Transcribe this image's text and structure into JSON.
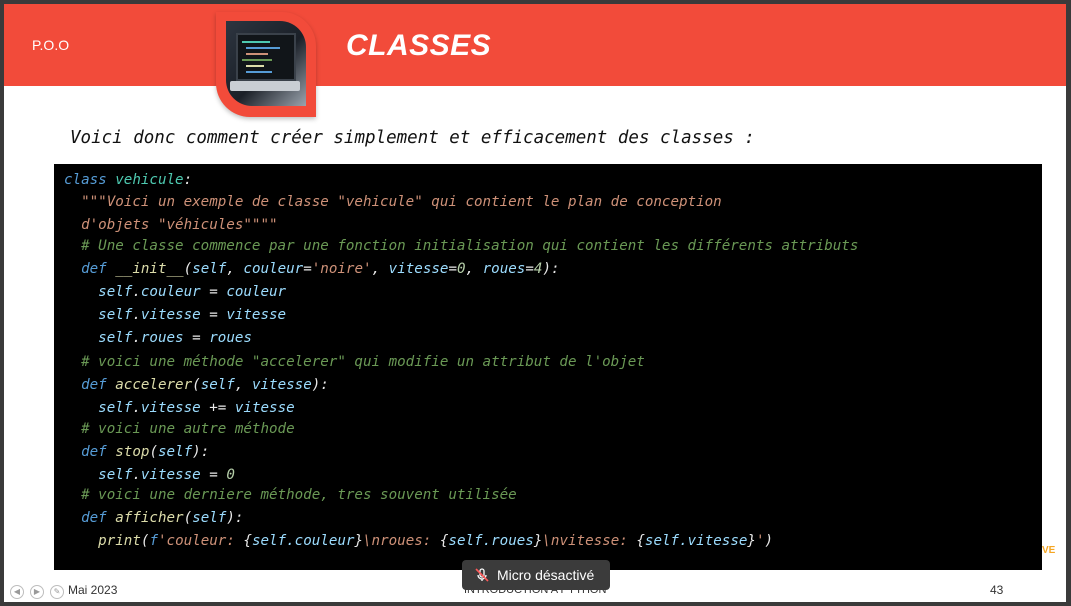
{
  "header": {
    "subtitle": "P.O.O",
    "title": "CLASSES"
  },
  "intro": "Voici donc comment créer simplement et efficacement des classes :",
  "code": {
    "lines": [
      {
        "indent": "",
        "parts": [
          [
            "kw",
            "class "
          ],
          [
            "cls",
            "vehicule"
          ],
          [
            "txt",
            ":"
          ]
        ]
      },
      {
        "indent": "  ",
        "parts": [
          [
            "str",
            "\"\"\"Voici un exemple de classe \"vehicule\" qui contient le plan de conception"
          ]
        ]
      },
      {
        "indent": "  ",
        "parts": [
          [
            "str",
            "d'objets \"véhicules\"\"\"\""
          ]
        ]
      },
      {
        "indent": "  ",
        "parts": [
          [
            "cmt",
            "# Une classe commence par une fonction initialisation qui contient les différents attributs"
          ]
        ]
      },
      {
        "indent": "  ",
        "parts": [
          [
            "kw",
            "def "
          ],
          [
            "fn",
            "__init__"
          ],
          [
            "txt",
            "("
          ],
          [
            "var",
            "self"
          ],
          [
            "txt",
            ", "
          ],
          [
            "var",
            "couleur"
          ],
          [
            "txt",
            "="
          ],
          [
            "str",
            "'noire'"
          ],
          [
            "txt",
            ", "
          ],
          [
            "var",
            "vitesse"
          ],
          [
            "txt",
            "="
          ],
          [
            "num",
            "0"
          ],
          [
            "txt",
            ", "
          ],
          [
            "var",
            "roues"
          ],
          [
            "txt",
            "="
          ],
          [
            "num",
            "4"
          ],
          [
            "txt",
            "):"
          ]
        ]
      },
      {
        "indent": "    ",
        "parts": [
          [
            "var",
            "self"
          ],
          [
            "txt",
            "."
          ],
          [
            "var",
            "couleur"
          ],
          [
            "txt",
            " = "
          ],
          [
            "var",
            "couleur"
          ]
        ]
      },
      {
        "indent": "    ",
        "parts": [
          [
            "var",
            "self"
          ],
          [
            "txt",
            "."
          ],
          [
            "var",
            "vitesse"
          ],
          [
            "txt",
            " = "
          ],
          [
            "var",
            "vitesse"
          ]
        ]
      },
      {
        "indent": "    ",
        "parts": [
          [
            "var",
            "self"
          ],
          [
            "txt",
            "."
          ],
          [
            "var",
            "roues"
          ],
          [
            "txt",
            " = "
          ],
          [
            "var",
            "roues"
          ]
        ]
      },
      {
        "indent": "  ",
        "parts": [
          [
            "cmt",
            "# voici une méthode \"accelerer\" qui modifie un attribut de l'objet"
          ]
        ]
      },
      {
        "indent": "  ",
        "parts": [
          [
            "kw",
            "def "
          ],
          [
            "fn",
            "accelerer"
          ],
          [
            "txt",
            "("
          ],
          [
            "var",
            "self"
          ],
          [
            "txt",
            ", "
          ],
          [
            "var",
            "vitesse"
          ],
          [
            "txt",
            "):"
          ]
        ]
      },
      {
        "indent": "    ",
        "parts": [
          [
            "var",
            "self"
          ],
          [
            "txt",
            "."
          ],
          [
            "var",
            "vitesse"
          ],
          [
            "txt",
            " += "
          ],
          [
            "var",
            "vitesse"
          ]
        ]
      },
      {
        "indent": "  ",
        "parts": [
          [
            "cmt",
            "# voici une autre méthode"
          ]
        ]
      },
      {
        "indent": "  ",
        "parts": [
          [
            "kw",
            "def "
          ],
          [
            "fn",
            "stop"
          ],
          [
            "txt",
            "("
          ],
          [
            "var",
            "self"
          ],
          [
            "txt",
            "):"
          ]
        ]
      },
      {
        "indent": "    ",
        "parts": [
          [
            "var",
            "self"
          ],
          [
            "txt",
            "."
          ],
          [
            "var",
            "vitesse"
          ],
          [
            "txt",
            " = "
          ],
          [
            "num",
            "0"
          ]
        ]
      },
      {
        "indent": "  ",
        "parts": [
          [
            "cmt",
            "# voici une derniere méthode, tres souvent utilisée"
          ]
        ]
      },
      {
        "indent": "  ",
        "parts": [
          [
            "kw",
            "def "
          ],
          [
            "fn",
            "afficher"
          ],
          [
            "txt",
            "("
          ],
          [
            "var",
            "self"
          ],
          [
            "txt",
            "):"
          ]
        ]
      },
      {
        "indent": "    ",
        "parts": [
          [
            "fn",
            "print"
          ],
          [
            "txt",
            "("
          ],
          [
            "kw",
            "f"
          ],
          [
            "str",
            "'couleur: "
          ],
          [
            "txt",
            "{"
          ],
          [
            "var",
            "self.couleur"
          ],
          [
            "txt",
            "}"
          ],
          [
            "str",
            "\\nroues: "
          ],
          [
            "txt",
            "{"
          ],
          [
            "var",
            "self.roues"
          ],
          [
            "txt",
            "}"
          ],
          [
            "str",
            "\\nvitesse: "
          ],
          [
            "txt",
            "{"
          ],
          [
            "var",
            "self.vitesse"
          ],
          [
            "txt",
            "}"
          ],
          [
            "str",
            "'"
          ],
          [
            "txt",
            ")"
          ]
        ]
      }
    ],
    "line_tops": [
      0,
      22,
      45,
      66,
      89,
      112,
      135,
      158,
      182,
      205,
      228,
      249,
      272,
      295,
      315,
      338,
      361
    ]
  },
  "footer": {
    "date": "Mai 2023",
    "center": "INTRODUCTION A PYTHON",
    "page": "43",
    "mark": "VE"
  },
  "toast": {
    "label": "Micro désactivé",
    "icon": "mic-off-icon"
  },
  "colors": {
    "header": "#f24b3a",
    "code_bg": "#000000",
    "keyword": "#569cd6",
    "string": "#ce9178",
    "comment": "#6a9955"
  }
}
